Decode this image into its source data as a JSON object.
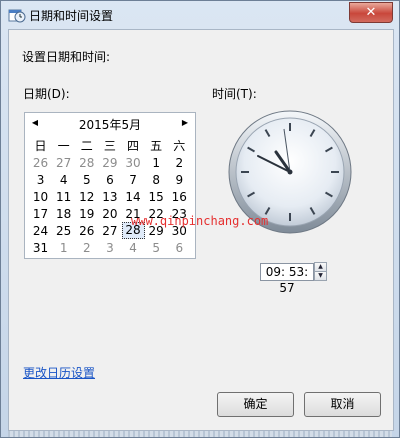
{
  "window": {
    "title": "日期和时间设置",
    "close_glyph": "✕"
  },
  "heading": "设置日期和时间:",
  "date_label": "日期(D):",
  "time_label": "时间(T):",
  "calendar": {
    "month_title": "2015年5月",
    "prev_glyph": "◀",
    "next_glyph": "▶",
    "weekdays": [
      "日",
      "一",
      "二",
      "三",
      "四",
      "五",
      "六"
    ],
    "weeks": [
      [
        "26",
        "27",
        "28",
        "29",
        "30",
        "1",
        "2"
      ],
      [
        "3",
        "4",
        "5",
        "6",
        "7",
        "8",
        "9"
      ],
      [
        "10",
        "11",
        "12",
        "13",
        "14",
        "15",
        "16"
      ],
      [
        "17",
        "18",
        "19",
        "20",
        "21",
        "22",
        "23"
      ],
      [
        "24",
        "25",
        "26",
        "27",
        "28",
        "29",
        "30"
      ],
      [
        "31",
        "1",
        "2",
        "3",
        "4",
        "5",
        "6"
      ]
    ]
  },
  "time_value": "09: 53: 57",
  "spin": {
    "up": "▲",
    "down": "▼"
  },
  "change_calendar_link": "更改日历设置",
  "ok_button": "确定",
  "cancel_button": "取消",
  "watermark": "www.qinpinchang.com"
}
